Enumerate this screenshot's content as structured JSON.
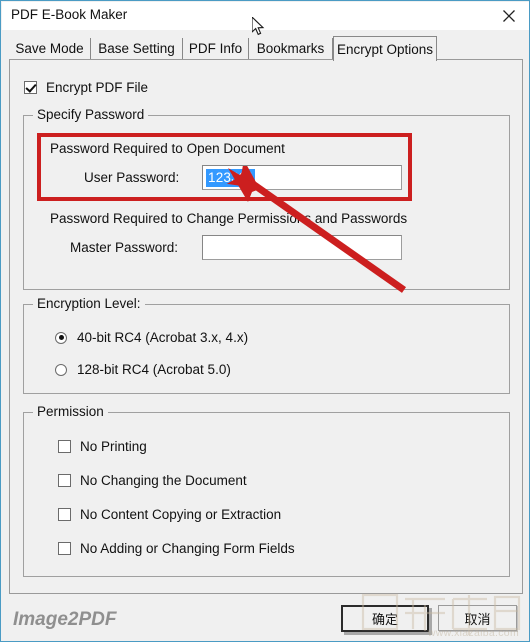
{
  "window": {
    "title": "PDF E-Book Maker",
    "close_icon": "close-icon"
  },
  "tabs": [
    {
      "label": "Save Mode",
      "selected": false
    },
    {
      "label": "Base Setting",
      "selected": false
    },
    {
      "label": "PDF Info",
      "selected": false
    },
    {
      "label": "Bookmarks",
      "selected": false
    },
    {
      "label": "Encrypt Options",
      "selected": true
    }
  ],
  "encrypt_pdf": {
    "label": "Encrypt PDF File",
    "checked": true
  },
  "specify_password": {
    "group_title": "Specify Password",
    "open_doc_caption": "Password Required to Open Document",
    "user_password_label": "User Password:",
    "user_password_value": "123321",
    "user_password_placeholder": "",
    "change_perm_caption": "Password Required to Change Permissions and Passwords",
    "master_password_label": "Master Password:",
    "master_password_value": "",
    "master_password_placeholder": ""
  },
  "encryption_level": {
    "group_title": "Encryption Level:",
    "options": [
      {
        "label": "40-bit RC4 (Acrobat 3.x, 4.x)",
        "selected": true
      },
      {
        "label": "128-bit RC4 (Acrobat 5.0)",
        "selected": false
      }
    ]
  },
  "permission": {
    "group_title": "Permission",
    "options": [
      {
        "label": "No Printing",
        "checked": false
      },
      {
        "label": "No Changing the Document",
        "checked": false
      },
      {
        "label": "No Content Copying or Extraction",
        "checked": false
      },
      {
        "label": "No Adding or Changing Form Fields",
        "checked": false
      }
    ]
  },
  "footer": {
    "brand": "Image2PDF",
    "ok_label": "确定",
    "cancel_label": "取消"
  },
  "watermark": {
    "url": "www.xiazaiba.com"
  },
  "annotation": {
    "highlight_color": "#cc1f1f",
    "arrow_color": "#cc1f1f",
    "selection_color": "#3399ff"
  }
}
